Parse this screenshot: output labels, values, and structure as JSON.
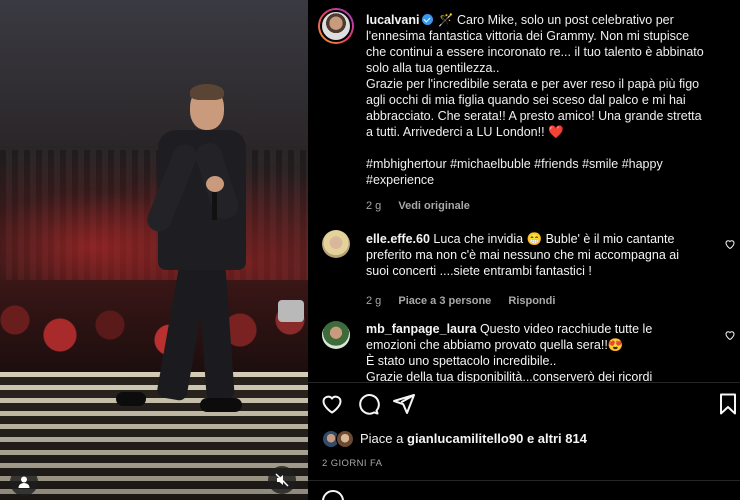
{
  "post": {
    "author": "lucalvani",
    "caption_lines": [
      "🪄 Caro Mike, solo un post celebrativo per",
      "l'ennesima fantastica vittoria dei Grammy. Non mi stupisce",
      "che continui a essere incoronato re... il tuo talento è abbinato",
      "solo alla tua gentilezza..",
      "Grazie per l'incredibile serata e per aver reso il papà più figo",
      "agli occhi di mia figlia quando sei sceso dal palco e mi hai",
      "abbracciato. Che serata!! A presto amico! Una grande stretta",
      "a tutti. Arrivederci a LU London!! ❤️"
    ],
    "hashtags_line1": "#mbhighertour #michaelbuble #friends #smile #happy",
    "hashtags_line2": "#experience",
    "time": "2 g",
    "see_original": "Vedi originale"
  },
  "comments": [
    {
      "username": "elle.effe.60",
      "text_lines": [
        "Luca che invidia 😁 Buble' è il mio cantante",
        "preferito ma non c'è mai nessuno che mi accompagna ai",
        "suoi concerti ....siete entrambi fantastici !"
      ],
      "time": "2 g",
      "likes": "Piace a 3 persone",
      "reply": "Rispondi"
    },
    {
      "username": "mb_fanpage_laura",
      "text_lines": [
        "Questo video racchiude tutte le",
        "emozioni che abbiamo provato quella sera!!😍",
        "È stato uno spettacolo incredibile..",
        "Grazie della tua disponibilità...conserverò dei ricordi"
      ]
    }
  ],
  "likes": {
    "prefix": "Piace a",
    "user": "gianlucamilitello90",
    "suffix": "e altri 814"
  },
  "date": "2 GIORNI FA",
  "colors": {
    "background": "#000000",
    "text": "#f5f5f5",
    "muted": "#a8a8a8",
    "verified": "#3897f0",
    "divider": "#262626"
  },
  "icons": [
    "user-tag-icon",
    "mute-icon",
    "heart-icon",
    "comment-icon",
    "share-icon",
    "bookmark-icon",
    "emoji-icon"
  ]
}
